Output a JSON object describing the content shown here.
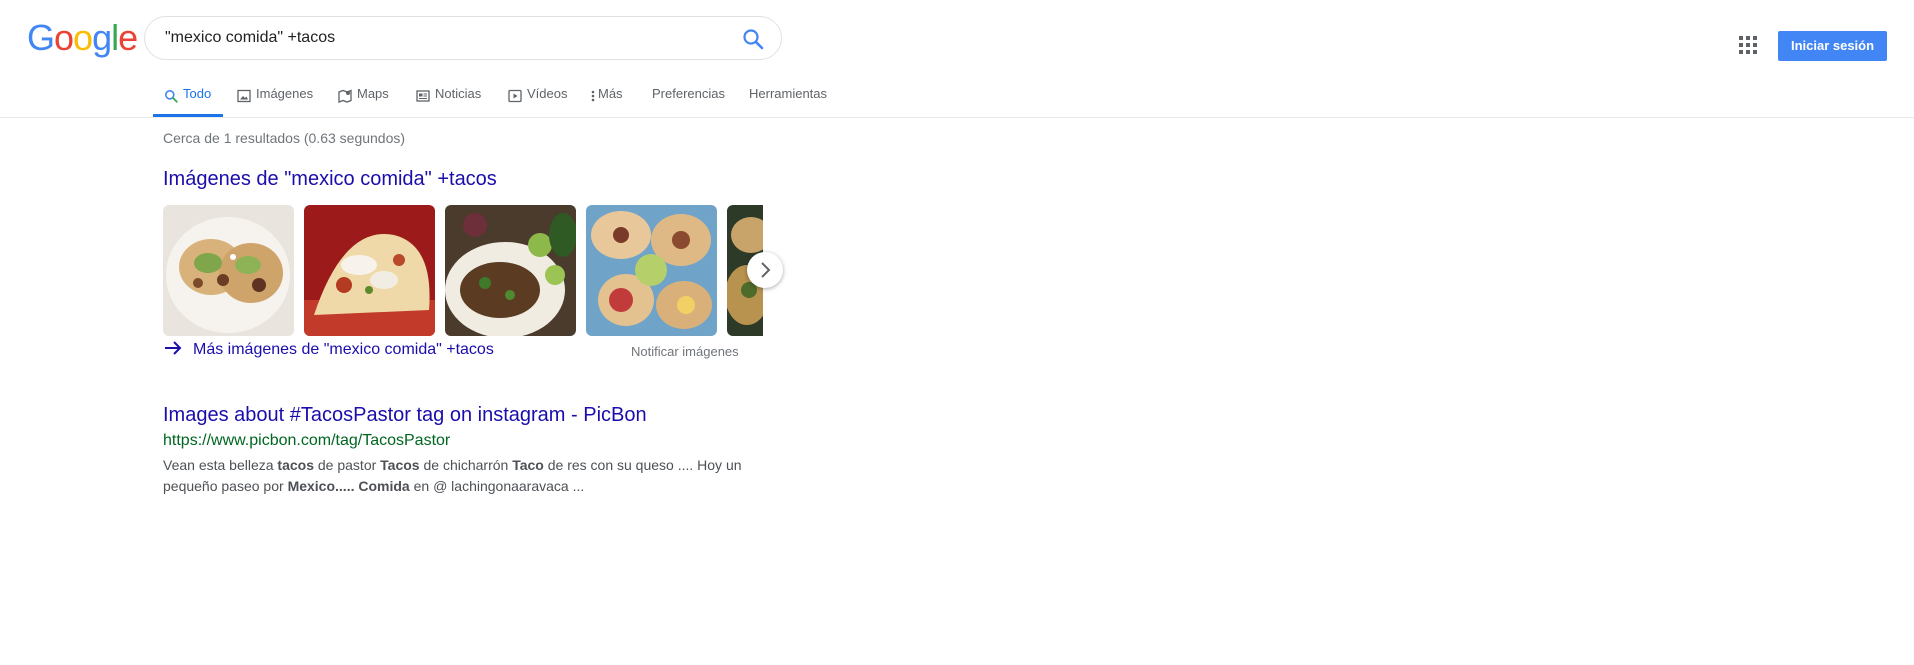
{
  "header": {
    "logo_letters": [
      {
        "ch": "G",
        "color": "#4285F4"
      },
      {
        "ch": "o",
        "color": "#EA4335"
      },
      {
        "ch": "o",
        "color": "#FBBC05"
      },
      {
        "ch": "g",
        "color": "#4285F4"
      },
      {
        "ch": "l",
        "color": "#34A853"
      },
      {
        "ch": "e",
        "color": "#EA4335"
      }
    ],
    "query": "\"mexico comida\" +tacos",
    "signin_label": "Iniciar sesión",
    "signin_color": "#4285f4"
  },
  "tabs": [
    {
      "label": "Todo",
      "icon": "search-icon",
      "active": true
    },
    {
      "label": "Imágenes",
      "icon": "image-icon",
      "active": false
    },
    {
      "label": "Maps",
      "icon": "map-icon",
      "active": false
    },
    {
      "label": "Noticias",
      "icon": "news-icon",
      "active": false
    },
    {
      "label": "Vídeos",
      "icon": "video-icon",
      "active": false
    },
    {
      "label": "Más",
      "icon": "more-vert-icon",
      "active": false
    },
    {
      "label": "Preferencias",
      "icon": null,
      "active": false
    },
    {
      "label": "Herramientas",
      "icon": null,
      "active": false
    }
  ],
  "results": {
    "stats": "Cerca de 1 resultados (0.63 segundos)",
    "images_heading": "Imágenes de \"mexico comida\" +tacos",
    "more_images": "Más imágenes de \"mexico comida\" +tacos",
    "report_images": "Notificar imágenes",
    "items": [
      {
        "title": "Images about #TacosPastor tag on instagram - PicBon",
        "url": "https://www.picbon.com/tag/TacosPastor",
        "snippet_line1": [
          {
            "t": "Vean esta belleza ",
            "b": false
          },
          {
            "t": "tacos",
            "b": true
          },
          {
            "t": " de pastor ",
            "b": false
          },
          {
            "t": "Tacos",
            "b": true
          },
          {
            "t": " de chicharrón ",
            "b": false
          },
          {
            "t": "Taco",
            "b": true
          },
          {
            "t": " de res con su queso .... Hoy un",
            "b": false
          }
        ],
        "snippet_line2": [
          {
            "t": "pequeño paseo por ",
            "b": false
          },
          {
            "t": "Mexico.....",
            "b": true
          },
          {
            "t": " ",
            "b": false
          },
          {
            "t": "Comida",
            "b": true
          },
          {
            "t": " en @ lachingonaaravaca ...",
            "b": false
          }
        ]
      }
    ]
  },
  "colors": {
    "link": "#1a0dab",
    "url_green": "#006621",
    "active_tab": "#1a73e8"
  }
}
